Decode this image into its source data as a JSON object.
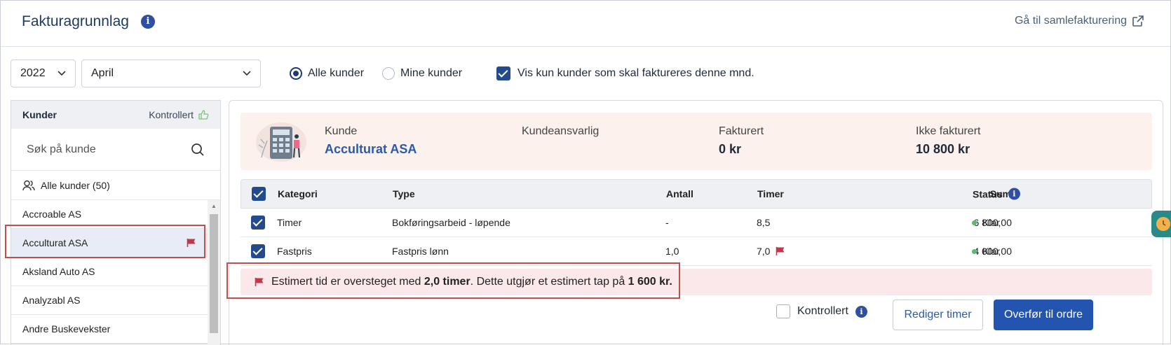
{
  "header": {
    "title": "Fakturagrunnlag",
    "collective_link": "Gå til samlefakturering"
  },
  "filters": {
    "year": "2022",
    "month": "April",
    "radio_all": "Alle kunder",
    "radio_mine": "Mine kunder",
    "selected_radio": "Alle kunder",
    "only_invoice_label": "Vis kun kunder som skal faktureres denne mnd.",
    "only_invoice_checked": true
  },
  "sidebar": {
    "header_label": "Kunder",
    "controlled_label": "Kontrollert",
    "search_placeholder": "Søk på kunde",
    "all_customers": "Alle kunder (50)",
    "customers": [
      {
        "name": "Accroable AS",
        "selected": false,
        "flagged": false
      },
      {
        "name": "Acculturat ASA",
        "selected": true,
        "flagged": true
      },
      {
        "name": "Aksland Auto AS",
        "selected": false,
        "flagged": false
      },
      {
        "name": "Analyzabl AS",
        "selected": false,
        "flagged": false
      },
      {
        "name": "Andre Buskevekster",
        "selected": false,
        "flagged": false
      }
    ]
  },
  "summary": {
    "customer_label": "Kunde",
    "customer_name": "Acculturat ASA",
    "manager_label": "Kundeansvarlig",
    "invoiced_label": "Fakturert",
    "invoiced_value": "0 kr",
    "not_invoiced_label": "Ikke fakturert",
    "not_invoiced_value": "10 800 kr"
  },
  "table": {
    "headers": {
      "category": "Kategori",
      "type": "Type",
      "count": "Antall",
      "hours": "Timer",
      "sum": "Sum",
      "status": "Status"
    },
    "rows": [
      {
        "category": "Timer",
        "type": "Bokføringsarbeid - løpende",
        "count": "-",
        "hours": "8,5",
        "flag": false,
        "sum": "6 800,00",
        "status": "Klar"
      },
      {
        "category": "Fastpris",
        "type": "Fastpris lønn",
        "count": "1,0",
        "hours": "7,0",
        "flag": true,
        "sum": "4 000,00",
        "status": "Klar"
      }
    ]
  },
  "warning": {
    "part1": "Estimert tid er oversteget med ",
    "hours": "2,0 timer",
    "part2": ". Dette utgjør et estimert tap på ",
    "loss": "1 600 kr."
  },
  "footer": {
    "controlled_label": "Kontrollert",
    "edit_button": "Rediger timer",
    "transfer_button": "Overfør til ordre"
  },
  "colors": {
    "primary": "#2354b0",
    "flag": "#c0394b",
    "status_ready": "#5bb974",
    "highlight": "#c0504d"
  }
}
